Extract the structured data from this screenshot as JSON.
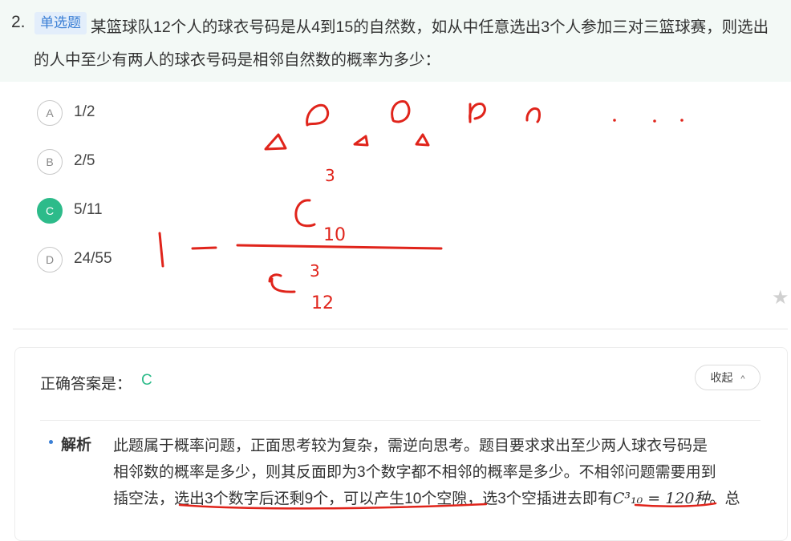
{
  "question": {
    "number": "2.",
    "tag": "单选题",
    "line1": "某篮球队12个人的球衣号码是从4到15的自然数，如从中任意选出3个人参加三对三篮球赛，则选出",
    "line2": "的人中至少有两人的球衣号码是相邻自然数的概率为多少："
  },
  "options": [
    {
      "letter": "A",
      "text": "1/2",
      "selected": false
    },
    {
      "letter": "B",
      "text": "2/5",
      "selected": false
    },
    {
      "letter": "C",
      "text": "5/11",
      "selected": true
    },
    {
      "letter": "D",
      "text": "24/55",
      "selected": false
    }
  ],
  "handwriting": {
    "formula": {
      "lead": "1",
      "top": "C",
      "top_sup": "3",
      "top_sub": "10",
      "bottom": "C",
      "bottom_sup": "3",
      "bottom_sub": "12"
    },
    "color": "#e0241b"
  },
  "icons": {
    "favorite": "star-icon",
    "collapse": "chevron-up-icon"
  },
  "answer": {
    "label": "正确答案是：",
    "value": "C",
    "collapse_label": "收起"
  },
  "analysis": {
    "title": "解析",
    "line1": "此题属于概率问题，正面思考较为复杂，需逆向思考。题目要求求出至少两人球衣号码是",
    "line2": "相邻数的概率是多少，则其反面即为3个数字都不相邻的概率是多少。不相邻问题需要用到",
    "line3_a": "插空法，选出3个数字后还剩9个，可以产生10个空隙，选3个空插进去即有",
    "line3_math": "C³₁₀ = 120种",
    "line3_b": "。总"
  },
  "colors": {
    "accent": "#2dbb8a",
    "tag_text": "#3a7fd5",
    "tag_bg": "#e3eefb",
    "header_bg": "#f3f9f6",
    "ink": "#e0241b"
  }
}
